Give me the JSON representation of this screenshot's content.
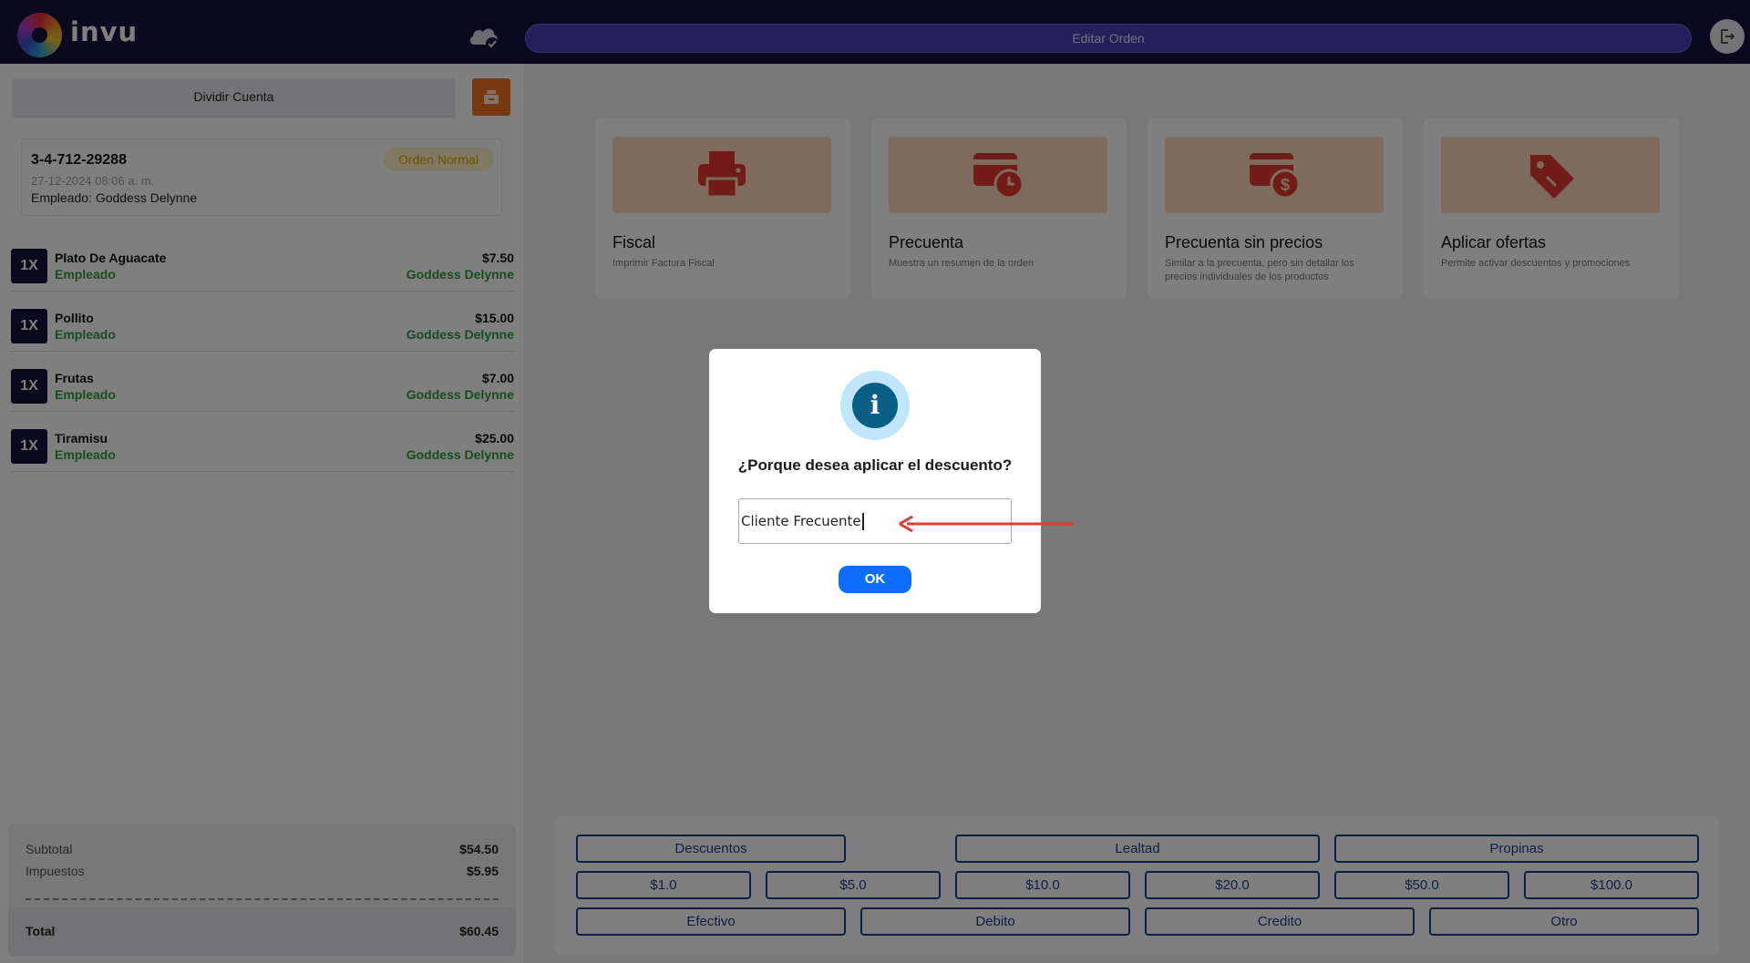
{
  "header": {
    "brand": "invu",
    "edit_order_label": "Editar Orden"
  },
  "left_panel": {
    "divide_label": "Dividir Cuenta",
    "order": {
      "id": "3-4-712-29288",
      "date": "27-12-2024 08:06 a. m.",
      "employee": "Empleado: Goddess Delynne",
      "badge": "Orden Normal"
    },
    "items": [
      {
        "qty": "1X",
        "name": "Plato De Aguacate",
        "sub": "Empleado",
        "price": "$7.50",
        "employee": "Goddess Delynne"
      },
      {
        "qty": "1X",
        "name": "Pollito",
        "sub": "Empleado",
        "price": "$15.00",
        "employee": "Goddess Delynne"
      },
      {
        "qty": "1X",
        "name": "Frutas",
        "sub": "Empleado",
        "price": "$7.00",
        "employee": "Goddess Delynne"
      },
      {
        "qty": "1X",
        "name": "Tiramisu",
        "sub": "Empleado",
        "price": "$25.00",
        "employee": "Goddess Delynne"
      }
    ],
    "totals": {
      "subtotal_label": "Subtotal",
      "subtotal": "$54.50",
      "tax_label": "Impuestos",
      "tax": "$5.95",
      "total_label": "Total",
      "total": "$60.45"
    }
  },
  "actions": [
    {
      "title": "Fiscal",
      "desc": "Imprimir Factura Fiscal",
      "icon": "printer-icon"
    },
    {
      "title": "Precuenta",
      "desc": "Muestra un resumen de la orden",
      "icon": "card-clock-icon"
    },
    {
      "title": "Precuenta sin precios",
      "desc": "Similar a la precuenta, pero sin detallar los precios individuales de los productos",
      "icon": "card-dollar-icon"
    },
    {
      "title": "Aplicar ofertas",
      "desc": "Permite activar descuentos y promociones",
      "icon": "tag-icon"
    }
  ],
  "payment": {
    "row1": [
      "Descuentos",
      "Lealtad",
      "Propinas"
    ],
    "row2": [
      "$1.0",
      "$5.0",
      "$10.0",
      "$20.0",
      "$50.0",
      "$100.0"
    ],
    "row3": [
      "Efectivo",
      "Debito",
      "Credito",
      "Otro"
    ]
  },
  "dialog": {
    "icon": "info-icon",
    "title": "¿Porque desea aplicar el descuento?",
    "input_value": "Cliente Frecuente",
    "ok_label": "OK"
  },
  "colors": {
    "header_bg": "#17133a",
    "accent_purple": "#4b3fb8",
    "green": "#2e9b3a",
    "icon_red": "#e53935",
    "ok_blue": "#0d6efd"
  }
}
